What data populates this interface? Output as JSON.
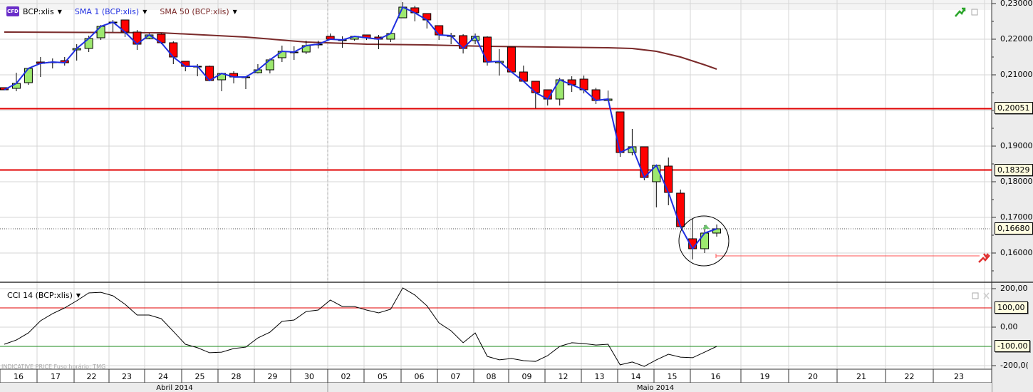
{
  "legend": {
    "symbol_badge": "CFD",
    "symbol": "BCP:xlis",
    "sma1": "SMA 1 (BCP:xlis)",
    "sma50": "SMA 50 (BCP:xlis)",
    "cci": "CCI 14 (BCP:xlis)"
  },
  "footer": {
    "note": "INDICATIVE PRICE    Fuso horário: TMG"
  },
  "colors": {
    "up": "#9de86f",
    "down": "#ff0000",
    "sma1": "#1f2ee0",
    "sma50": "#7a2a2a",
    "hline": "#e00000",
    "cci_upper": "#e00000",
    "cci_lower": "#1a8a1a"
  },
  "chart_data": [
    {
      "type": "candlestick",
      "title": "BCP:xlis",
      "ylim": [
        0.155,
        0.231
      ],
      "y_ticks": [
        "0,23000",
        "0,22000",
        "0,21000",
        "0,19000",
        "0,18000",
        "0,17000",
        "0,16000"
      ],
      "y_tick_values": [
        0.23,
        0.22,
        0.21,
        0.19,
        0.18,
        0.17,
        0.16
      ],
      "horizontal_lines": [
        {
          "value": 0.20051,
          "label": "0,20051"
        },
        {
          "value": 0.18329,
          "label": "0,18329"
        }
      ],
      "last_price": {
        "value": 0.1668,
        "label": "0,16680"
      },
      "alert_level": 0.1592,
      "candles": [
        [
          0.2064,
          0.2064,
          0.2058,
          0.2058
        ],
        [
          0.2062,
          0.2106,
          0.2054,
          0.2076
        ],
        [
          0.2078,
          0.2118,
          0.2072,
          0.2118
        ],
        [
          0.2136,
          0.215,
          0.2094,
          0.2132
        ],
        [
          0.2136,
          0.2146,
          0.2118,
          0.2136
        ],
        [
          0.214,
          0.215,
          0.2126,
          0.2134
        ],
        [
          0.217,
          0.2186,
          0.214,
          0.2174
        ],
        [
          0.2174,
          0.221,
          0.2164,
          0.2202
        ],
        [
          0.2204,
          0.224,
          0.2198,
          0.2236
        ],
        [
          0.2248,
          0.2254,
          0.222,
          0.2248
        ],
        [
          0.2254,
          0.2254,
          0.2206,
          0.222
        ],
        [
          0.222,
          0.2226,
          0.217,
          0.2186
        ],
        [
          0.2202,
          0.2216,
          0.22,
          0.2212
        ],
        [
          0.2214,
          0.2216,
          0.2186,
          0.219
        ],
        [
          0.219,
          0.2194,
          0.213,
          0.215
        ],
        [
          0.2138,
          0.2138,
          0.211,
          0.2124
        ],
        [
          0.2124,
          0.213,
          0.2096,
          0.2124
        ],
        [
          0.2124,
          0.2126,
          0.2082,
          0.2084
        ],
        [
          0.2086,
          0.2106,
          0.2054,
          0.2104
        ],
        [
          0.2104,
          0.211,
          0.2076,
          0.2094
        ],
        [
          0.2094,
          0.2096,
          0.206,
          0.2094
        ],
        [
          0.2106,
          0.213,
          0.2104,
          0.2114
        ],
        [
          0.2114,
          0.2146,
          0.2104,
          0.2142
        ],
        [
          0.2148,
          0.2182,
          0.2136,
          0.2166
        ],
        [
          0.2164,
          0.218,
          0.2142,
          0.2164
        ],
        [
          0.2164,
          0.2196,
          0.2158,
          0.2182
        ],
        [
          0.2186,
          0.2196,
          0.2174,
          0.2186
        ],
        [
          0.2208,
          0.2216,
          0.22,
          0.22
        ],
        [
          0.2198,
          0.2208,
          0.2176,
          0.2198
        ],
        [
          0.22,
          0.2208,
          0.2196,
          0.2208
        ],
        [
          0.2212,
          0.2212,
          0.2198,
          0.2204
        ],
        [
          0.2206,
          0.2212,
          0.2172,
          0.22
        ],
        [
          0.22,
          0.2216,
          0.2192,
          0.2216
        ],
        [
          0.226,
          0.2304,
          0.226,
          0.229
        ],
        [
          0.2288,
          0.2294,
          0.225,
          0.2274
        ],
        [
          0.2272,
          0.2272,
          0.223,
          0.2254
        ],
        [
          0.2238,
          0.2238,
          0.2198,
          0.2212
        ],
        [
          0.221,
          0.2218,
          0.2186,
          0.221
        ],
        [
          0.221,
          0.2214,
          0.216,
          0.2174
        ],
        [
          0.2196,
          0.2216,
          0.2186,
          0.2208
        ],
        [
          0.2206,
          0.2208,
          0.2126,
          0.2136
        ],
        [
          0.2134,
          0.2172,
          0.2098,
          0.2138
        ],
        [
          0.2178,
          0.2178,
          0.2108,
          0.2108
        ],
        [
          0.2108,
          0.2126,
          0.2082,
          0.2082
        ],
        [
          0.2082,
          0.2082,
          0.2006,
          0.205
        ],
        [
          0.2058,
          0.2058,
          0.2014,
          0.2032
        ],
        [
          0.2032,
          0.2092,
          0.2014,
          0.2086
        ],
        [
          0.2086,
          0.2096,
          0.2052,
          0.2072
        ],
        [
          0.2088,
          0.2098,
          0.2048,
          0.2058
        ],
        [
          0.2058,
          0.2064,
          0.2018,
          0.2028
        ],
        [
          0.2028,
          0.2056,
          0.2028,
          0.2032
        ],
        [
          0.1996,
          0.1996,
          0.187,
          0.1882
        ],
        [
          0.1882,
          0.1948,
          0.1874,
          0.1898
        ],
        [
          0.1898,
          0.1898,
          0.1804,
          0.1812
        ],
        [
          0.18,
          0.1846,
          0.1728,
          0.1846
        ],
        [
          0.1844,
          0.1868,
          0.1734,
          0.177
        ],
        [
          0.1768,
          0.1778,
          0.1674,
          0.1674
        ],
        [
          0.164,
          0.1696,
          0.1582,
          0.1612
        ],
        [
          0.1612,
          0.1678,
          0.16,
          0.1656
        ],
        [
          0.1656,
          0.168,
          0.1646,
          0.1668
        ]
      ],
      "candle_fields": [
        "open",
        "high",
        "low",
        "close"
      ],
      "sma50_points": [
        [
          0,
          0.222
        ],
        [
          13,
          0.2218
        ],
        [
          20,
          0.2206
        ],
        [
          25,
          0.2192
        ],
        [
          30,
          0.2186
        ],
        [
          35,
          0.2184
        ],
        [
          40,
          0.218
        ],
        [
          45,
          0.2178
        ],
        [
          50,
          0.2176
        ],
        [
          52,
          0.2174
        ],
        [
          54,
          0.2166
        ],
        [
          56,
          0.215
        ],
        [
          58,
          0.2128
        ],
        [
          59,
          0.2116
        ]
      ]
    },
    {
      "type": "line",
      "title": "CCI 14 (BCP:xlis)",
      "ylim": [
        -215,
        210
      ],
      "y_ticks": [
        "200,00",
        "0,00",
        "-200,0("
      ],
      "y_tick_values": [
        200,
        0,
        -200
      ],
      "levels": [
        {
          "value": 100,
          "label": "100,00"
        },
        {
          "value": -100,
          "label": "-100,00"
        }
      ],
      "values": [
        -89,
        -67,
        -30,
        33,
        70,
        100,
        137,
        178,
        181,
        163,
        119,
        63,
        63,
        44,
        -22,
        -89,
        -107,
        -133,
        -130,
        -111,
        -104,
        -56,
        -26,
        30,
        37,
        81,
        89,
        141,
        107,
        107,
        89,
        74,
        93,
        204,
        167,
        111,
        22,
        -19,
        -81,
        -30,
        -152,
        -170,
        -163,
        -174,
        -178,
        -148,
        -100,
        -81,
        -85,
        -93,
        -89,
        -196,
        -181,
        -204,
        -170,
        -141,
        -156,
        -159,
        -130,
        -100
      ]
    }
  ],
  "x_axis": {
    "dates": [
      "16",
      "17",
      "22",
      "23",
      "24",
      "25",
      "28",
      "29",
      "30",
      "02",
      "05",
      "06",
      "07",
      "08",
      "09",
      "12",
      "13",
      "14",
      "15",
      "16",
      "19",
      "20",
      "21",
      "22",
      "23"
    ],
    "months": [
      "Abril 2014",
      "Maio 2014"
    ]
  }
}
